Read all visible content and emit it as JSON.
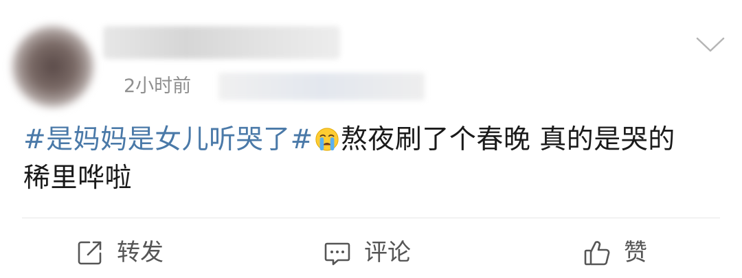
{
  "header": {
    "time": "2小时前",
    "menu_icon": "chevron-down-icon"
  },
  "post": {
    "topic": "#是妈妈是女儿听哭了#",
    "emoji": "crying-face-emoji",
    "text_line1": "熬夜刷了个春晚 真的是哭的",
    "text_line2": "稀里哗啦"
  },
  "actions": {
    "repost_label": "转发",
    "comment_label": "评论",
    "like_label": "赞",
    "repost_icon": "share-icon",
    "comment_icon": "comment-icon",
    "like_icon": "thumbs-up-icon"
  },
  "colors": {
    "topic": "#4a79a8",
    "text": "#1a1a1a",
    "muted": "#8f8f8f",
    "action": "#555555"
  }
}
